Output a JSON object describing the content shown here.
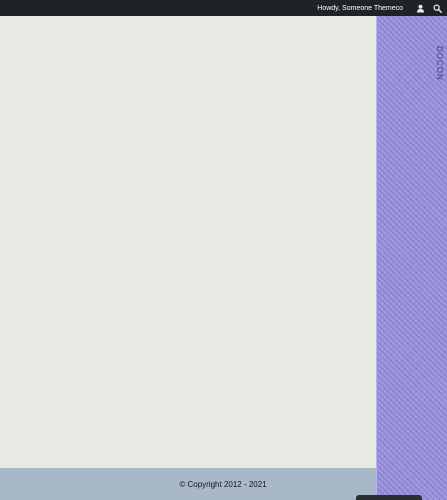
{
  "admin_bar": {
    "greeting": "Howdy, Someone Themeco",
    "user_icon": "user-icon",
    "search_icon": "search-icon"
  },
  "side_panel": {
    "vertical_label": "DOCON"
  },
  "footer": {
    "copyright": "© Copyright 2012 - 2021"
  },
  "colors": {
    "admin_bar_bg": "#1d2327",
    "page_bg": "#e7e9e2",
    "side_panel_bg": "#9a93de",
    "footer_bg": "#a8b8c8"
  }
}
